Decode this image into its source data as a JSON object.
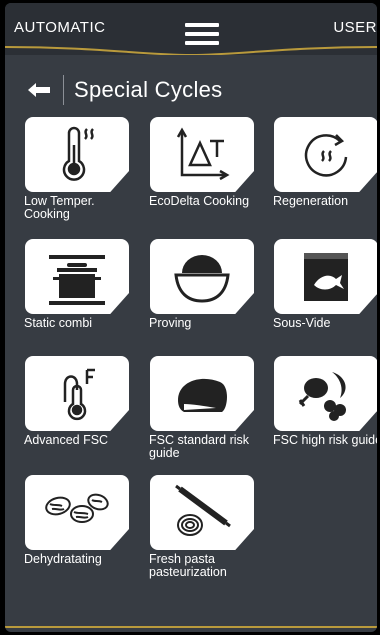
{
  "topbar": {
    "mode_label": "AUTOMATIC",
    "user_label": "USER"
  },
  "header": {
    "title": "Special Cycles"
  },
  "tiles": [
    {
      "label": "Low Temper. Cooking",
      "icon": "thermometer-steam-icon"
    },
    {
      "label": "EcoDelta Cooking",
      "icon": "delta-t-chart-icon"
    },
    {
      "label": "Regeneration",
      "icon": "regeneration-icon"
    },
    {
      "label": "Static combi",
      "icon": "pot-icon"
    },
    {
      "label": "Proving",
      "icon": "bowl-dough-icon"
    },
    {
      "label": "Sous-Vide",
      "icon": "vacuum-bag-fish-icon"
    },
    {
      "label": "Advanced FSC",
      "icon": "probe-thermometer-f-icon"
    },
    {
      "label": "FSC standard risk guide",
      "icon": "meat-cut-icon"
    },
    {
      "label": "FSC high risk guide",
      "icon": "poultry-egg-icon"
    },
    {
      "label": "Dehydratating",
      "icon": "dried-fruit-icon"
    },
    {
      "label": "Fresh pasta pasteurization",
      "icon": "rolling-pin-pasta-icon"
    }
  ],
  "colors": {
    "background": "#373c43",
    "topbar": "#2b2f35",
    "accent": "#b99a3c",
    "tile": "#ffffff"
  }
}
